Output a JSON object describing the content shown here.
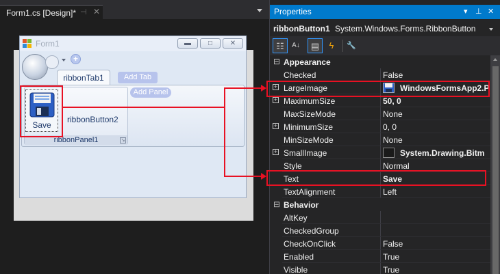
{
  "document_tab": {
    "title": "Form1.cs [Design]*",
    "pin_glyph": "⊣",
    "close_glyph": "✕"
  },
  "form": {
    "title": "Form1",
    "min_glyph": "▬",
    "max_glyph": "□",
    "close_glyph": "✕",
    "qat_add_glyph": "+",
    "ribbon_tab": "ribbonTab1",
    "add_tab": "Add Tab",
    "add_panel": "Add Panel",
    "panel_caption": "ribbonPanel1",
    "panel_launcher_glyph": "↘",
    "save_button_label": "Save",
    "ribbon_button2_label": "ribbonButton2"
  },
  "properties": {
    "title": "Properties",
    "title_icons": {
      "dropdown": "▾",
      "pin": "⊥",
      "close": "✕"
    },
    "object_name": "ribbonButton1",
    "object_type": "System.Windows.Forms.RibbonButton",
    "toolbar": [
      {
        "name": "categorized-icon",
        "glyph": "☷"
      },
      {
        "name": "alphabetical-icon",
        "glyph": "A↓"
      },
      {
        "name": "properties-icon",
        "glyph": "▤"
      },
      {
        "name": "events-icon",
        "glyph": "ϟ"
      },
      {
        "name": "property-pages-icon",
        "glyph": "🔧"
      }
    ],
    "rows": [
      {
        "kind": "category",
        "name": "Appearance",
        "expander": "⊟"
      },
      {
        "kind": "prop",
        "name": "Checked",
        "value": "False"
      },
      {
        "kind": "prop",
        "name": "LargeImage",
        "value": "WindowsFormsApp2.P",
        "expander": "+",
        "icon": "image-thumbnail",
        "bold": true
      },
      {
        "kind": "prop",
        "name": "MaximumSize",
        "value": "50, 0",
        "expander": "+",
        "bold": true
      },
      {
        "kind": "prop",
        "name": "MaxSizeMode",
        "value": "None"
      },
      {
        "kind": "prop",
        "name": "MinimumSize",
        "value": "0, 0",
        "expander": "+"
      },
      {
        "kind": "prop",
        "name": "MinSizeMode",
        "value": "None"
      },
      {
        "kind": "prop",
        "name": "SmallImage",
        "value": "System.Drawing.Bitm",
        "expander": "+",
        "icon": "empty-swatch",
        "bold": true
      },
      {
        "kind": "prop",
        "name": "Style",
        "value": "Normal"
      },
      {
        "kind": "prop",
        "name": "Text",
        "value": "Save",
        "bold": true
      },
      {
        "kind": "prop",
        "name": "TextAlignment",
        "value": "Left"
      },
      {
        "kind": "category",
        "name": "Behavior",
        "expander": "⊟"
      },
      {
        "kind": "prop",
        "name": "AltKey",
        "value": ""
      },
      {
        "kind": "prop",
        "name": "CheckedGroup",
        "value": ""
      },
      {
        "kind": "prop",
        "name": "CheckOnClick",
        "value": "False"
      },
      {
        "kind": "prop",
        "name": "Enabled",
        "value": "True"
      },
      {
        "kind": "prop",
        "name": "Visible",
        "value": "True"
      }
    ]
  },
  "colors": {
    "accent": "#007acc",
    "annotation_red": "#e81123",
    "panel_bg": "#252526",
    "editor_bg": "#1e1e1e"
  }
}
